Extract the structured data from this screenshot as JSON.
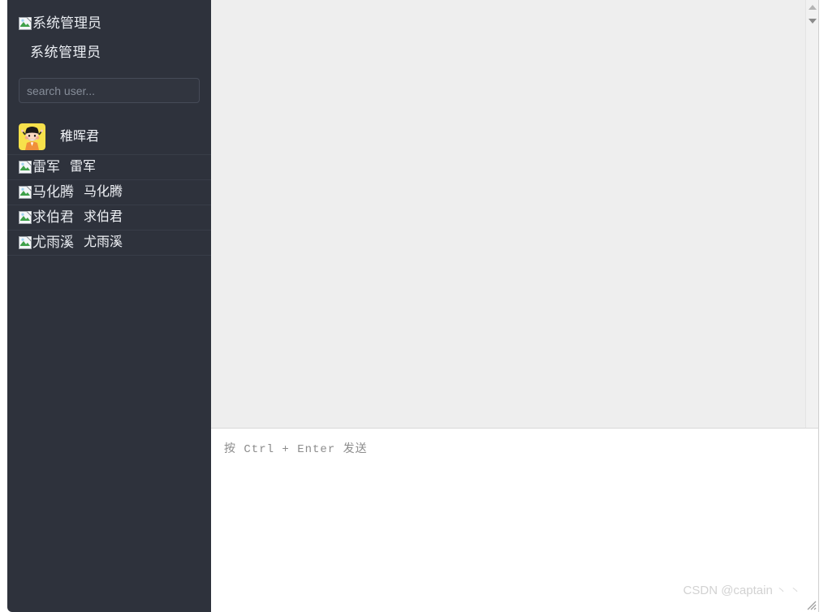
{
  "colors": {
    "sidebar_bg": "#2e323c",
    "sidebar_divider": "#383d48",
    "chat_bg": "#eeeeee",
    "composer_bg": "#ffffff",
    "text_light": "#f0f2f6",
    "placeholder": "#868d99",
    "watermark": "#d2d2d2",
    "avatar_bg": "#f6e04a"
  },
  "sidebar": {
    "header": {
      "avatar_icon": "broken-image-icon",
      "avatar_alt": "系统管理员",
      "display_name": "系统管理员"
    },
    "search": {
      "icon": "search-input",
      "placeholder": "search user...",
      "value": ""
    },
    "users": [
      {
        "name": "稚晖君",
        "avatar_kind": "image",
        "avatar_alt": "稚晖君",
        "avatar_icon": "cartoon-avatar"
      },
      {
        "name": "雷军",
        "avatar_kind": "broken-image",
        "avatar_alt": "雷军",
        "avatar_icon": "broken-image-icon"
      },
      {
        "name": "马化腾",
        "avatar_kind": "broken-image",
        "avatar_alt": "马化腾",
        "avatar_icon": "broken-image-icon"
      },
      {
        "name": "求伯君",
        "avatar_kind": "broken-image",
        "avatar_alt": "求伯君",
        "avatar_icon": "broken-image-icon"
      },
      {
        "name": "尤雨溪",
        "avatar_kind": "broken-image",
        "avatar_alt": "尤雨溪",
        "avatar_icon": "broken-image-icon"
      }
    ]
  },
  "chat": {
    "messages": [],
    "scrollbar": {
      "up_icon": "scroll-up-arrow-icon",
      "down_icon": "scroll-down-arrow-icon"
    }
  },
  "composer": {
    "placeholder": "按 Ctrl + Enter 发送",
    "value": "",
    "resize_icon": "resize-handle-icon"
  },
  "watermark": {
    "text": "CSDN @captain",
    "tail": "丶丶"
  }
}
